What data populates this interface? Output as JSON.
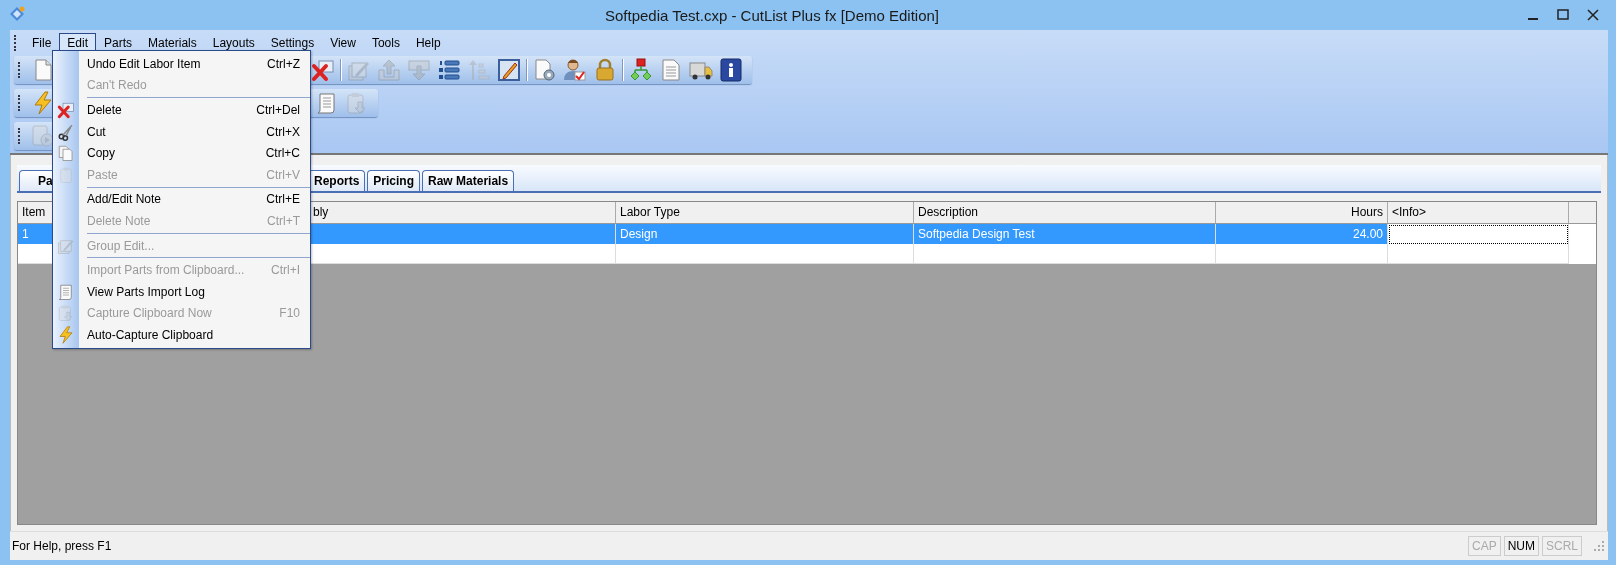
{
  "window": {
    "title": "Softpedia Test.cxp - CutList Plus fx [Demo Edition]"
  },
  "menubar": [
    {
      "label": "File",
      "selected": false
    },
    {
      "label": "Edit",
      "selected": true
    },
    {
      "label": "Parts",
      "selected": false
    },
    {
      "label": "Materials",
      "selected": false
    },
    {
      "label": "Layouts",
      "selected": false
    },
    {
      "label": "Settings",
      "selected": false
    },
    {
      "label": "View",
      "selected": false
    },
    {
      "label": "Tools",
      "selected": false
    },
    {
      "label": "Help",
      "selected": false
    }
  ],
  "edit_menu": [
    {
      "kind": "item",
      "label": "Undo Edit Labor Item",
      "shortcut": "Ctrl+Z",
      "disabled": false
    },
    {
      "kind": "item",
      "label": "Can't Redo",
      "disabled": true
    },
    {
      "kind": "separator"
    },
    {
      "kind": "item",
      "label": "Delete",
      "shortcut": "Ctrl+Del",
      "disabled": false
    },
    {
      "kind": "item",
      "label": "Cut",
      "shortcut": "Ctrl+X",
      "disabled": false
    },
    {
      "kind": "item",
      "label": "Copy",
      "shortcut": "Ctrl+C",
      "disabled": false
    },
    {
      "kind": "item",
      "label": "Paste",
      "shortcut": "Ctrl+V",
      "disabled": true
    },
    {
      "kind": "separator"
    },
    {
      "kind": "item",
      "label": "Add/Edit Note",
      "shortcut": "Ctrl+E",
      "disabled": false
    },
    {
      "kind": "item",
      "label": "Delete Note",
      "shortcut": "Ctrl+T",
      "disabled": true
    },
    {
      "kind": "separator"
    },
    {
      "kind": "item",
      "label": "Group Edit...",
      "disabled": true
    },
    {
      "kind": "separator"
    },
    {
      "kind": "item",
      "label": "Import Parts from Clipboard...",
      "shortcut": "Ctrl+I",
      "disabled": true
    },
    {
      "kind": "item",
      "label": "View Parts Import Log",
      "disabled": false
    },
    {
      "kind": "item",
      "label": "Capture Clipboard Now",
      "shortcut": "F10",
      "disabled": true
    },
    {
      "kind": "item",
      "label": "Auto-Capture Clipboard",
      "disabled": false
    }
  ],
  "toolbars": [
    {
      "start": [
        {
          "kind": "button",
          "disabled": false
        }
      ],
      "end": [
        {
          "kind": "button",
          "disabled": false
        },
        {
          "kind": "separator"
        },
        {
          "kind": "button",
          "disabled": true
        },
        {
          "kind": "button",
          "disabled": true
        },
        {
          "kind": "button",
          "disabled": true
        },
        {
          "kind": "button",
          "disabled": false
        },
        {
          "kind": "button",
          "disabled": true
        },
        {
          "kind": "button",
          "disabled": false
        },
        {
          "kind": "separator"
        },
        {
          "kind": "button",
          "disabled": false
        },
        {
          "kind": "button",
          "disabled": false
        },
        {
          "kind": "button",
          "disabled": false
        },
        {
          "kind": "separator"
        },
        {
          "kind": "button",
          "disabled": false
        },
        {
          "kind": "button",
          "disabled": false
        },
        {
          "kind": "button",
          "disabled": false
        },
        {
          "kind": "button",
          "disabled": false
        }
      ]
    },
    {
      "start": [
        {
          "kind": "button",
          "disabled": false
        }
      ],
      "end": [
        {
          "kind": "separator"
        },
        {
          "kind": "button",
          "disabled": false
        },
        {
          "kind": "button",
          "disabled": true
        }
      ]
    },
    {
      "start": [
        {
          "kind": "button",
          "disabled": true
        }
      ]
    }
  ],
  "tabs": [
    {
      "label": "Pa",
      "selected": false
    },
    {
      "label": "Reports",
      "selected": false
    },
    {
      "label": "Pricing",
      "selected": false
    },
    {
      "label": "Raw Materials",
      "selected": false
    }
  ],
  "table": {
    "columns": [
      "Item",
      "bly",
      "Labor Type",
      "Description",
      "Hours",
      "<Info>"
    ],
    "rows": [
      {
        "selected": true,
        "cells": [
          {
            "text": "1",
            "focused": false
          },
          {
            "focused": false
          },
          {
            "text": "Design",
            "focused": false
          },
          {
            "text": "Softpedia Design Test",
            "focused": false
          },
          {
            "text": "24.00",
            "focused": false
          },
          {
            "focused": true
          }
        ]
      }
    ]
  },
  "status_bar": {
    "text": "For Help, press F1",
    "indicators": [
      {
        "label": "CAP",
        "on": false
      },
      {
        "label": "NUM",
        "on": true
      },
      {
        "label": "SCRL",
        "on": false
      }
    ]
  }
}
